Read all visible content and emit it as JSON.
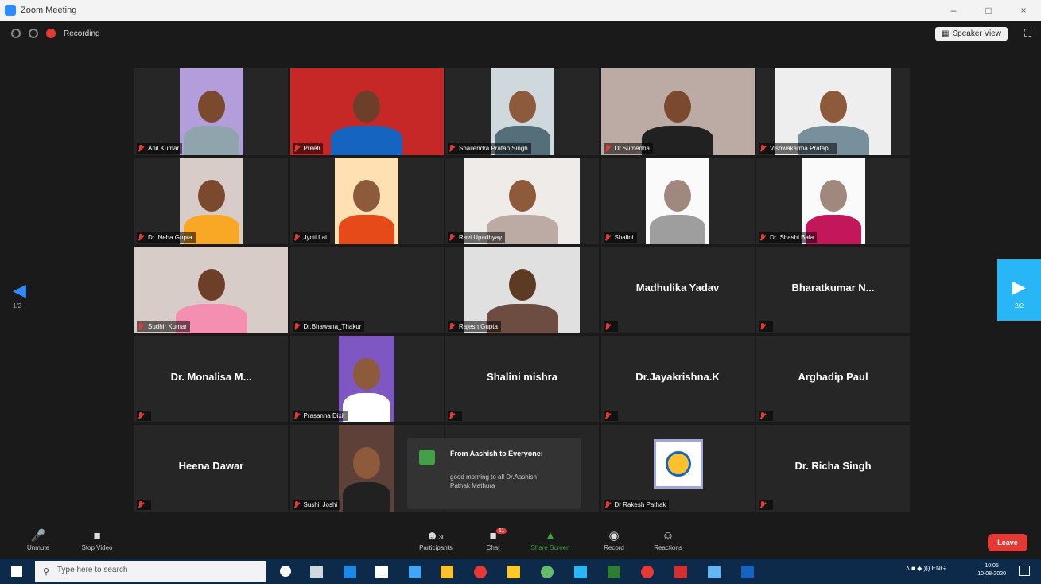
{
  "window": {
    "title": "Zoom Meeting"
  },
  "topbar": {
    "recording_label": "Recording",
    "speaker_view_label": "Speaker View"
  },
  "tiles": [
    {
      "name": "Anil Kumar",
      "type": "video",
      "bg": "#b39ddb",
      "skin": "#7b4a2e",
      "shirt": "#90a4ae",
      "vw": 80
    },
    {
      "name": "Preeti",
      "type": "video",
      "bg": "#c62828",
      "skin": "#6d3f28",
      "shirt": "#1565c0",
      "vw": 193
    },
    {
      "name": "Shailendra Pratap Singh",
      "type": "video",
      "bg": "#cfd8dc",
      "skin": "#8d5a3b",
      "shirt": "#546e7a",
      "vw": 80
    },
    {
      "name": "Dr.Sumedha",
      "type": "video",
      "bg": "#bcaaa4",
      "skin": "#7b4a2e",
      "shirt": "#212121",
      "vw": 193
    },
    {
      "name": "Vishwakarma Pratap...",
      "type": "video",
      "bg": "#eeeeee",
      "skin": "#8d5a3b",
      "shirt": "#78909c",
      "vw": 145
    },
    {
      "name": "Dr. Neha Gupta",
      "type": "video",
      "bg": "#d7ccc8",
      "skin": "#7b4a2e",
      "shirt": "#f9a825",
      "vw": 80
    },
    {
      "name": "Jyoti Lal",
      "type": "video",
      "bg": "#ffe0b2",
      "skin": "#8d5a3b",
      "shirt": "#e64a19",
      "vw": 80
    },
    {
      "name": "Ravi Upadhyay",
      "type": "video",
      "bg": "#efebe9",
      "skin": "#8d5a3b",
      "shirt": "#bcaaa4",
      "vw": 145
    },
    {
      "name": "Shalini",
      "type": "video",
      "bg": "#fafafa",
      "skin": "#a1887f",
      "shirt": "#9e9e9e",
      "vw": 80
    },
    {
      "name": "Dr. Shashi Bala",
      "type": "video",
      "bg": "#fafafa",
      "skin": "#a1887f",
      "shirt": "#c2185b",
      "vw": 80
    },
    {
      "name": "Sudhir Kumar",
      "type": "video",
      "bg": "#d7ccc8",
      "skin": "#6d3f28",
      "shirt": "#f48fb1",
      "vw": 193
    },
    {
      "name": "Dr.Bhawana_Thakur",
      "type": "name",
      "display": ""
    },
    {
      "name": "Rajesh Gupta",
      "type": "video",
      "bg": "#e0e0e0",
      "skin": "#5d3a24",
      "shirt": "#6d4c41",
      "vw": 145
    },
    {
      "name": "",
      "type": "name",
      "display": "Madhulika Yadav"
    },
    {
      "name": "",
      "type": "name",
      "display": "Bharatkumar  N..."
    },
    {
      "name": "",
      "type": "name",
      "display": "Dr. Monalisa  M..."
    },
    {
      "name": "Prasanna Dixit",
      "type": "video",
      "bg": "#7e57c2",
      "skin": "#8d5a3b",
      "shirt": "#ffffff",
      "vw": 70
    },
    {
      "name": "",
      "type": "name",
      "display": "Shalini mishra"
    },
    {
      "name": "",
      "type": "name",
      "display": "Dr.Jayakrishna.K"
    },
    {
      "name": "",
      "type": "name",
      "display": "Arghadip Paul"
    },
    {
      "name": "",
      "type": "name",
      "display": "Heena Dawar"
    },
    {
      "name": "Sushil Joshi",
      "type": "video",
      "bg": "#5d4037",
      "skin": "#8d5a3b",
      "shirt": "#212121",
      "vw": 70
    },
    {
      "name": "",
      "type": "empty"
    },
    {
      "name": "Dr Rakesh Pathak",
      "type": "logo"
    },
    {
      "name": "",
      "type": "name",
      "display": "Dr. Richa Singh"
    }
  ],
  "chat": {
    "from": "From Aashish to Everyone:",
    "message": "good morning to all Dr.Aashish Pathak Mathura"
  },
  "nav": {
    "left_page": "1/2",
    "right_page": "2/2"
  },
  "toolbar": {
    "mute": "Unmute",
    "video": "Stop Video",
    "participants": "Participants",
    "participants_count": "30",
    "chat": "Chat",
    "chat_badge": "11",
    "share": "Share Screen",
    "record": "Record",
    "reactions": "Reactions",
    "leave": "Leave"
  },
  "taskbar": {
    "search_placeholder": "Type here to search",
    "tray": "˄  ■  ◆  )))  ENG",
    "time": "10:05",
    "date": "10-08-2020"
  }
}
